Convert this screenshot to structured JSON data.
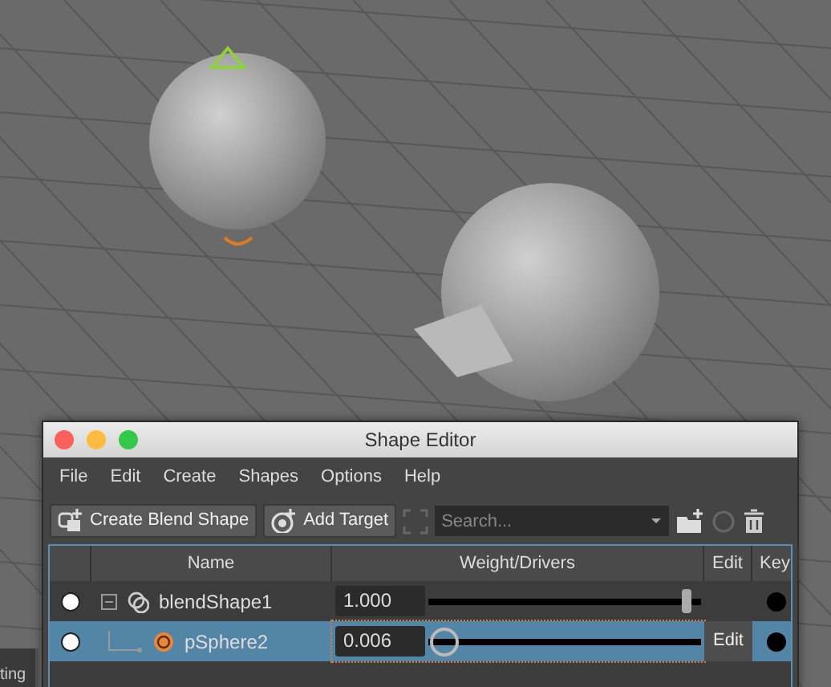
{
  "side_panel": {
    "label": "ting"
  },
  "window": {
    "title": "Shape Editor"
  },
  "menu": [
    "File",
    "Edit",
    "Create",
    "Shapes",
    "Options",
    "Help"
  ],
  "toolbar": {
    "buttons": [
      {
        "kind": "blend",
        "label": "Create Blend Shape"
      },
      {
        "kind": "target",
        "label": "Add Target"
      }
    ],
    "search": {
      "placeholder": "Search..."
    }
  },
  "table": {
    "columns": [
      "Name",
      "Weight/Drivers",
      "Edit",
      "Key"
    ],
    "rows": [
      {
        "kind": "blendshape",
        "name": "blendShape1",
        "expanded": true,
        "selected": false,
        "weight": "1.000",
        "level": 1.0
      },
      {
        "kind": "target",
        "name": "pSphere2",
        "selected": true,
        "weight": "0.006",
        "level": 0.006,
        "edit": "Edit"
      }
    ]
  }
}
